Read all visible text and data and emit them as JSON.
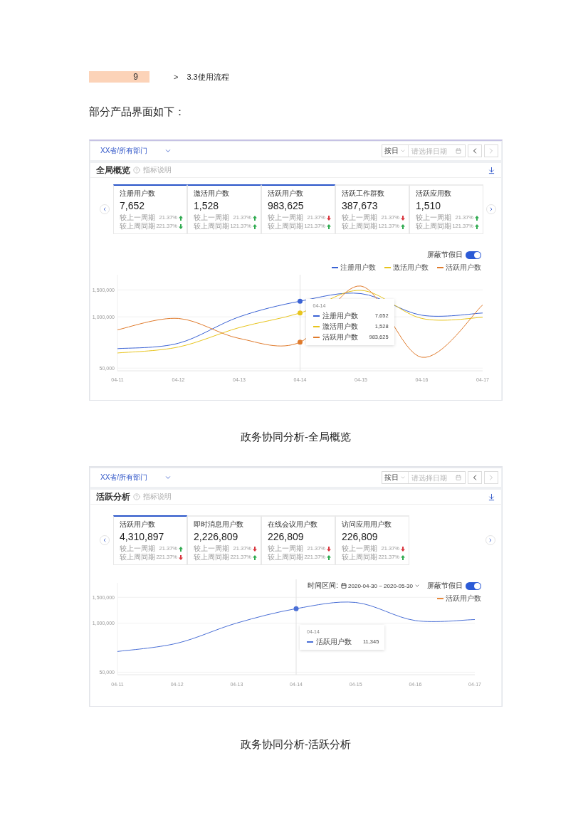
{
  "header": {
    "page_number": "9",
    "separator": ">",
    "section": "3.3使用流程"
  },
  "intro": "部分产品界面如下：",
  "figures": [
    {
      "toolbar": {
        "scope": "XX省/所有部门",
        "period": "按日",
        "date_placeholder": "请选择日期",
        "nav": [
          {
            "kind": "prev",
            "disabled": false
          },
          {
            "kind": "next",
            "disabled": true
          }
        ]
      },
      "panel": {
        "title": "全局概览",
        "help": "指标说明"
      },
      "cards": [
        {
          "label": "注册用户数",
          "value": "7,652",
          "selected": true,
          "comparisons": [
            {
              "label": "较上一周期",
              "change": "21.37%",
              "kind": "up",
              "color": "#2eaa4f"
            },
            {
              "label": "较上周同期",
              "change": "221.37%",
              "kind": "down",
              "color": "#2eaa4f"
            }
          ]
        },
        {
          "label": "激活用户数",
          "value": "1,528",
          "selected": true,
          "comparisons": [
            {
              "label": "较上一周期",
              "change": "21.37%",
              "kind": "up",
              "color": "#2eaa4f"
            },
            {
              "label": "较上周同期",
              "change": "121.37%",
              "kind": "up",
              "color": "#2eaa4f"
            }
          ]
        },
        {
          "label": "活跃用户数",
          "value": "983,625",
          "selected": true,
          "comparisons": [
            {
              "label": "较上一周期",
              "change": "21.37%",
              "kind": "down",
              "color": "#d9363e"
            },
            {
              "label": "较上周同期",
              "change": "121.37%",
              "kind": "up",
              "color": "#2eaa4f"
            }
          ]
        },
        {
          "label": "活跃工作群数",
          "value": "387,673",
          "selected": false,
          "comparisons": [
            {
              "label": "较上一周期",
              "change": "21.37%",
              "kind": "down",
              "color": "#d9363e"
            },
            {
              "label": "较上周同期",
              "change": "121.37%",
              "kind": "up",
              "color": "#2eaa4f"
            }
          ]
        },
        {
          "label": "活跃应用数",
          "value": "1,510",
          "selected": false,
          "comparisons": [
            {
              "label": "较上一周期",
              "change": "21.37%",
              "kind": "up",
              "color": "#2eaa4f"
            },
            {
              "label": "较上周同期",
              "change": "121.37%",
              "kind": "up",
              "color": "#2eaa4f"
            }
          ]
        }
      ],
      "filters": {
        "toggle_label": "屏蔽节假日",
        "toggle_on": true
      },
      "legend": [
        {
          "label": "注册用户数",
          "color": "#3a62d4"
        },
        {
          "label": "激活用户数",
          "color": "#e8c41c"
        },
        {
          "label": "活跃用户数",
          "color": "#e07b2c"
        }
      ],
      "chart_data": {
        "type": "line",
        "categories": [
          "04-11",
          "04-12",
          "04-13",
          "04-14",
          "04-15",
          "04-16",
          "04-17"
        ],
        "series": [
          {
            "name": "注册用户数",
            "color": "#3a62d4",
            "values": [
              410000,
              510000,
              1000000,
              1290000,
              1430000,
              1030000,
              1070000
            ]
          },
          {
            "name": "激活用户数",
            "color": "#e8c41c",
            "values": [
              330000,
              440000,
              800000,
              1070000,
              1490000,
              970000,
              990000
            ]
          },
          {
            "name": "活跃用户数",
            "color": "#e07b2c",
            "values": [
              760000,
              970000,
              600000,
              530000,
              1570000,
              250000,
              1220000
            ]
          }
        ],
        "ylim": [
          0,
          1780000
        ],
        "yticks": [
          {
            "value": 50000,
            "label": "50,000"
          },
          {
            "value": 1000000,
            "label": "1,000,000"
          },
          {
            "value": 1500000,
            "label": "1,500,000"
          }
        ],
        "grid": true,
        "ref_lines": [
          {
            "axis": "x",
            "value": "04-14"
          }
        ]
      },
      "tooltip": {
        "title": "04-14",
        "values": [
          "7,652",
          "1,528",
          "983,625"
        ]
      },
      "caption": "政务协同分析-全局概览"
    },
    {
      "toolbar": {
        "scope": "XX省/所有部门",
        "period": "按日",
        "date_placeholder": "请选择日期",
        "nav": [
          {
            "kind": "prev",
            "disabled": false
          },
          {
            "kind": "next",
            "disabled": true
          }
        ]
      },
      "panel": {
        "title": "活跃分析",
        "help": "指标说明"
      },
      "cards": [
        {
          "label": "活跃用户数",
          "value": "4,310,897",
          "selected": true,
          "comparisons": [
            {
              "label": "较上一周期",
              "change": "21.37%",
              "kind": "up",
              "color": "#2eaa4f"
            },
            {
              "label": "较上周同期",
              "change": "221.37%",
              "kind": "down",
              "color": "#d9363e"
            }
          ]
        },
        {
          "label": "即时消息用户数",
          "value": "2,226,809",
          "selected": false,
          "comparisons": [
            {
              "label": "较上一周期",
              "change": "21.37%",
              "kind": "down",
              "color": "#d9363e"
            },
            {
              "label": "较上周同期",
              "change": "221.37%",
              "kind": "up",
              "color": "#2eaa4f"
            }
          ]
        },
        {
          "label": "在线会议用户数",
          "value": "226,809",
          "selected": false,
          "comparisons": [
            {
              "label": "较上一周期",
              "change": "21.37%",
              "kind": "down",
              "color": "#d9363e"
            },
            {
              "label": "较上周同期",
              "change": "221.37%",
              "kind": "up",
              "color": "#2eaa4f"
            }
          ]
        },
        {
          "label": "访问应用用户数",
          "value": "226,809",
          "selected": false,
          "comparisons": [
            {
              "label": "较上一周期",
              "change": "21.37%",
              "kind": "down",
              "color": "#d9363e"
            },
            {
              "label": "较上周同期",
              "change": "221.37%",
              "kind": "up",
              "color": "#2eaa4f"
            }
          ]
        }
      ],
      "filters": {
        "range_label": "时间区间:",
        "range": "2020-04-30 ~ 2020-05-30",
        "toggle_label": "屏蔽节假日",
        "toggle_on": true
      },
      "legend": [
        {
          "label": "活跃用户数",
          "color": "#e8883a"
        }
      ],
      "chart_data": {
        "type": "line",
        "categories": [
          "04-11",
          "04-12",
          "04-13",
          "04-14",
          "04-15",
          "04-16",
          "04-17"
        ],
        "series": [
          {
            "name": "活跃用户数",
            "color": "#4a6fd6",
            "values": [
              450000,
              610000,
              1000000,
              1280000,
              1400000,
              1050000,
              1070000
            ]
          }
        ],
        "ylim": [
          0,
          1780000
        ],
        "yticks": [
          {
            "value": 50000,
            "label": "50,000"
          },
          {
            "value": 1000000,
            "label": "1,000,000"
          },
          {
            "value": 1500000,
            "label": "1,500,000"
          }
        ],
        "grid": true,
        "ref_lines": [
          {
            "axis": "x",
            "value": "04-14"
          }
        ]
      },
      "tooltip": {
        "title": "04-14",
        "values": [
          "11,345"
        ]
      },
      "caption": "政务协同分析-活跃分析"
    }
  ]
}
